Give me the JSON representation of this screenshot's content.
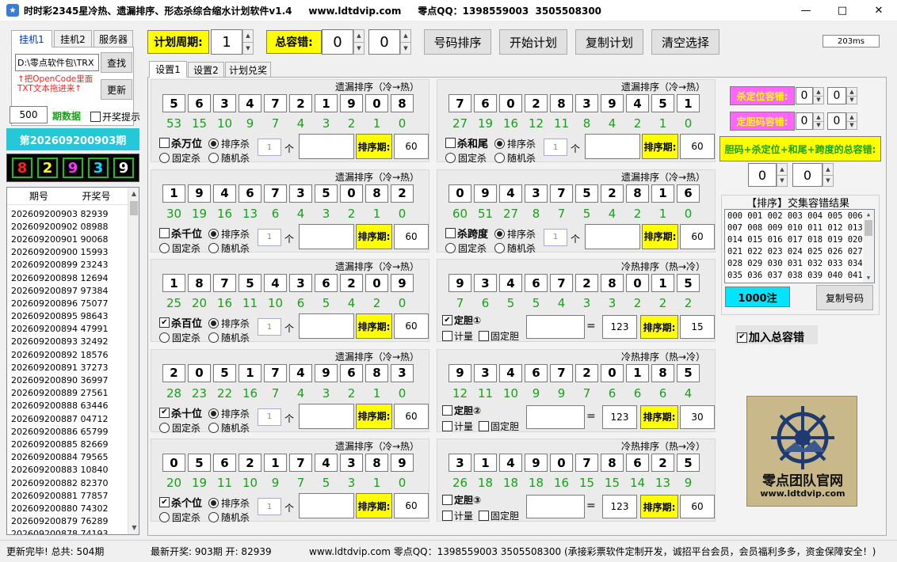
{
  "window": {
    "title": "时时彩2345星冷热、遗漏排序、形态杀综合缩水计划软件v1.4     www.ldtdvip.com     零点QQ：1398559003  3505508300"
  },
  "left_tabs": [
    "挂机1",
    "挂机2",
    "服务器"
  ],
  "path_input": "D:\\零点软件包\\TRX",
  "find_btn": "查找",
  "update_btn": "更新",
  "hint": "↑把OpenCode里面TXT文本拖进来↑",
  "periods_value": "500",
  "periods_label": "期数据",
  "lottery_prompt": "开奖提示",
  "current_period": "第202609200903期",
  "current_digits": [
    "8",
    "2",
    "9",
    "3",
    "9"
  ],
  "history": {
    "headers": [
      "期号",
      "开奖号"
    ],
    "rows": [
      [
        "202609200903",
        "82939"
      ],
      [
        "202609200902",
        "08988"
      ],
      [
        "202609200901",
        "90068"
      ],
      [
        "202609200900",
        "15993"
      ],
      [
        "202609200899",
        "23243"
      ],
      [
        "202609200898",
        "12694"
      ],
      [
        "202609200897",
        "97384"
      ],
      [
        "202609200896",
        "75077"
      ],
      [
        "202609200895",
        "98643"
      ],
      [
        "202609200894",
        "47991"
      ],
      [
        "202609200893",
        "32492"
      ],
      [
        "202609200892",
        "18576"
      ],
      [
        "202609200891",
        "37273"
      ],
      [
        "202609200890",
        "36997"
      ],
      [
        "202609200889",
        "27561"
      ],
      [
        "202609200888",
        "63446"
      ],
      [
        "202609200887",
        "04712"
      ],
      [
        "202609200886",
        "65799"
      ],
      [
        "202609200885",
        "82669"
      ],
      [
        "202609200884",
        "79565"
      ],
      [
        "202609200883",
        "10840"
      ],
      [
        "202609200882",
        "82370"
      ],
      [
        "202609200881",
        "77857"
      ],
      [
        "202609200880",
        "74302"
      ],
      [
        "202609200879",
        "76289"
      ],
      [
        "202609200878",
        "74193"
      ]
    ]
  },
  "toolbar": {
    "cycle_label": "计划周期:",
    "cycle_value": "1",
    "tol_label": "总容错:",
    "tol_a": "0",
    "tol_b": "0",
    "sort_btn": "号码排序",
    "start_btn": "开始计划",
    "copy_btn": "复制计划",
    "clear_btn": "清空选择",
    "ms": "203ms"
  },
  "main_tabs": [
    "设置1",
    "设置2",
    "计划兑奖"
  ],
  "left_panels": [
    {
      "title": "遗漏排序（冷→热）",
      "digits": [
        "5",
        "6",
        "3",
        "4",
        "7",
        "2",
        "1",
        "9",
        "0",
        "8"
      ],
      "nums": [
        "53",
        "15",
        "10",
        "9",
        "7",
        "4",
        "3",
        "2",
        "1",
        "0"
      ],
      "kill_label": "杀万位",
      "kill_checked": false,
      "n": "1",
      "ge": "个",
      "sort_period_label": "排序期:",
      "sort_period": "60"
    },
    {
      "title": "遗漏排序（冷→热）",
      "digits": [
        "1",
        "9",
        "4",
        "6",
        "7",
        "3",
        "5",
        "0",
        "8",
        "2"
      ],
      "nums": [
        "30",
        "19",
        "16",
        "13",
        "6",
        "4",
        "3",
        "2",
        "1",
        "0"
      ],
      "kill_label": "杀千位",
      "kill_checked": false,
      "n": "1",
      "ge": "个",
      "sort_period_label": "排序期:",
      "sort_period": "60"
    },
    {
      "title": "遗漏排序（冷→热）",
      "digits": [
        "1",
        "8",
        "7",
        "5",
        "4",
        "3",
        "6",
        "2",
        "0",
        "9"
      ],
      "nums": [
        "25",
        "20",
        "16",
        "11",
        "10",
        "6",
        "5",
        "4",
        "2",
        "0"
      ],
      "kill_label": "杀百位",
      "kill_checked": true,
      "n": "1",
      "ge": "个",
      "sort_period_label": "排序期:",
      "sort_period": "60"
    },
    {
      "title": "遗漏排序（冷→热）",
      "digits": [
        "2",
        "0",
        "5",
        "1",
        "7",
        "4",
        "9",
        "6",
        "8",
        "3"
      ],
      "nums": [
        "28",
        "23",
        "22",
        "16",
        "7",
        "4",
        "3",
        "2",
        "1",
        "0"
      ],
      "kill_label": "杀十位",
      "kill_checked": true,
      "n": "1",
      "ge": "个",
      "sort_period_label": "排序期:",
      "sort_period": "60"
    },
    {
      "title": "遗漏排序（冷→热）",
      "digits": [
        "0",
        "5",
        "6",
        "2",
        "1",
        "7",
        "4",
        "3",
        "8",
        "9"
      ],
      "nums": [
        "20",
        "19",
        "11",
        "10",
        "9",
        "7",
        "5",
        "3",
        "1",
        "0"
      ],
      "kill_label": "杀个位",
      "kill_checked": true,
      "n": "1",
      "ge": "个",
      "sort_period_label": "排序期:",
      "sort_period": "60"
    }
  ],
  "right_panels": [
    {
      "title": "遗漏排序（冷→热）",
      "digits": [
        "7",
        "6",
        "0",
        "2",
        "8",
        "3",
        "9",
        "4",
        "5",
        "1"
      ],
      "nums": [
        "27",
        "19",
        "16",
        "12",
        "11",
        "8",
        "4",
        "2",
        "1",
        "0"
      ],
      "kill_label": "杀和尾",
      "kill_checked": false,
      "n": "1",
      "ge": "个",
      "sort_period_label": "排序期:",
      "sort_period": "60"
    },
    {
      "title": "遗漏排序（冷→热）",
      "digits": [
        "0",
        "9",
        "4",
        "3",
        "7",
        "5",
        "2",
        "8",
        "1",
        "6"
      ],
      "nums": [
        "60",
        "51",
        "27",
        "8",
        "7",
        "5",
        "4",
        "2",
        "1",
        "0"
      ],
      "kill_label": "杀跨度",
      "kill_checked": false,
      "n": "1",
      "ge": "个",
      "sort_period_label": "排序期:",
      "sort_period": "60"
    }
  ],
  "dan_panels": [
    {
      "title": "冷热排序（热→冷）",
      "digits": [
        "9",
        "3",
        "4",
        "6",
        "7",
        "2",
        "8",
        "0",
        "1",
        "5"
      ],
      "nums": [
        "7",
        "6",
        "5",
        "5",
        "4",
        "3",
        "3",
        "2",
        "2",
        "2"
      ],
      "label": "定胆①",
      "checked": true,
      "eq": "=",
      "val": "123",
      "sort_period_label": "排序期:",
      "sort_period": "15"
    },
    {
      "title": "冷热排序（热→冷）",
      "digits": [
        "9",
        "3",
        "4",
        "6",
        "7",
        "2",
        "0",
        "1",
        "8",
        "5"
      ],
      "nums": [
        "12",
        "11",
        "10",
        "9",
        "9",
        "7",
        "6",
        "6",
        "6",
        "4"
      ],
      "label": "定胆②",
      "checked": false,
      "eq": "=",
      "val": "123",
      "sort_period_label": "排序期:",
      "sort_period": "30"
    },
    {
      "title": "冷热排序（热→冷）",
      "digits": [
        "3",
        "1",
        "4",
        "9",
        "0",
        "7",
        "8",
        "6",
        "2",
        "5"
      ],
      "nums": [
        "26",
        "18",
        "18",
        "18",
        "16",
        "15",
        "15",
        "14",
        "13",
        "9"
      ],
      "label": "定胆③",
      "checked": false,
      "eq": "=",
      "val": "123",
      "sort_period_label": "排序期:",
      "sort_period": "60"
    }
  ],
  "radio": {
    "sort_kill": "排序杀",
    "fixed_kill": "固定杀",
    "random_kill": "随机杀",
    "jiliang": "计量",
    "fixed_dan": "固定胆"
  },
  "right": {
    "kill_pos_tol": "杀定位容错:",
    "dan_tol": "定胆码容错:",
    "kp_a": "0",
    "kp_b": "0",
    "dt_a": "0",
    "dt_b": "0",
    "total_tol_label": "胆码+杀定位+和尾+跨度的总容错:",
    "tt_a": "0",
    "tt_b": "0",
    "result_title": "【排序】交集容错结果",
    "result_lines": [
      "000 001 002 003 004 005 006",
      "007 008 009 010 011 012 013",
      "014 015 016 017 018 019 020",
      "021 022 023 024 025 026 027",
      "028 029 030 031 032 033 034",
      "035 036 037 038 039 040 041"
    ],
    "count": "1000注",
    "copy_num": "复制号码",
    "add_total": "加入总容错",
    "logo_text": "零点团队官网",
    "logo_url": "www.ldtdvip.com"
  },
  "status": {
    "left": "更新完毕! 总共: 504期",
    "mid": "最新开奖: 903期 开: 82939",
    "right": "www.ldtdvip.com   零点QQ：1398559003  3505508300  (承接彩票软件定制开发，诚招平台会员，会员福利多多，资金保障安全！)"
  },
  "colors": {
    "digit_red": "#ff2020",
    "digit_yellow": "#ffff00",
    "digit_magenta": "#ff33ff",
    "digit_cyan": "#00e0ff",
    "digit_white": "#ffffff",
    "period_bar": "#25c8d8",
    "green_nums": "#19a019"
  }
}
